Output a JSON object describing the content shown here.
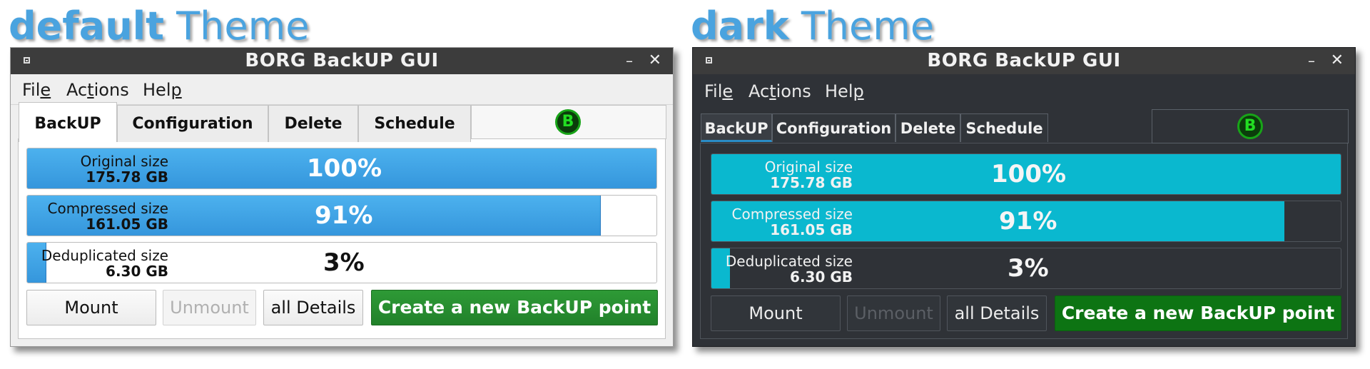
{
  "headings": {
    "default": {
      "name": "default",
      "word": "Theme"
    },
    "dark": {
      "name": "dark",
      "word": "Theme"
    }
  },
  "colors": {
    "heading": "#4aa3df",
    "default_bar": "#3a9fe3",
    "dark_bar": "#0ab8cf",
    "primary_default": "#258a2d",
    "primary_dark": "#0d7413"
  },
  "window": {
    "title": "BORG BackUP GUI",
    "system_menu_icon": "window-menu-icon",
    "minimize_glyph": "–",
    "close_glyph": "✕"
  },
  "menu": [
    {
      "pre": "Fil",
      "accel": "e",
      "post": ""
    },
    {
      "pre": "Ac",
      "accel": "t",
      "post": "ions"
    },
    {
      "pre": "Hel",
      "accel": "p",
      "post": ""
    }
  ],
  "tabs": [
    "BackUP",
    "Configuration",
    "Delete",
    "Schedule"
  ],
  "logo": {
    "letter": "B",
    "icon": "borg-logo-icon"
  },
  "stats": [
    {
      "label": "Original size",
      "size": "175.78 GB",
      "percent_text": "100%",
      "fraction": 1.0
    },
    {
      "label": "Compressed size",
      "size": "161.05 GB",
      "percent_text": "91%",
      "fraction": 0.91
    },
    {
      "label": "Deduplicated size",
      "size": "6.30 GB",
      "percent_text": "3%",
      "fraction": 0.03
    }
  ],
  "buttons": {
    "mount": "Mount",
    "unmount": "Unmount",
    "details": "all Details",
    "create": "Create a new BackUP point"
  }
}
